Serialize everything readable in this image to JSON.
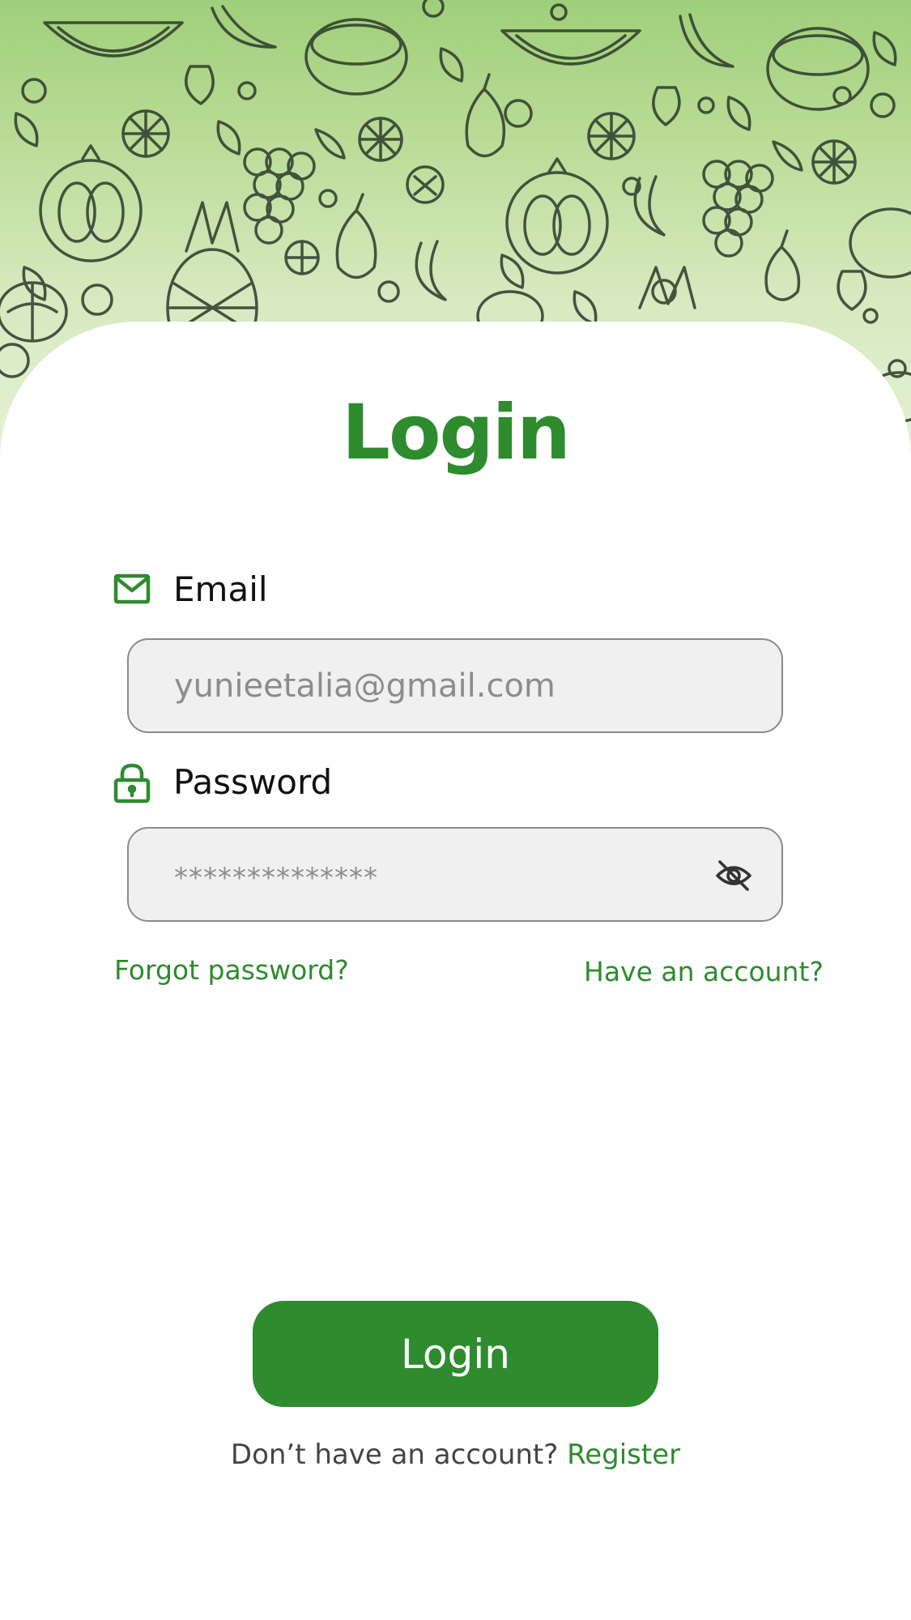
{
  "colors": {
    "accent": "#2e8b2e",
    "input_bg": "#f0f0f0",
    "input_border": "#8a8a8a",
    "placeholder": "#8c8c8c",
    "hero_top": "#9fcf7a",
    "hero_bottom": "#e8f2da"
  },
  "header": {
    "background": "fruit-doodle-pattern"
  },
  "page": {
    "title": "Login"
  },
  "email": {
    "icon": "envelope-icon",
    "label": "Email",
    "placeholder": "yunieetalia@gmail.com"
  },
  "password": {
    "icon": "lock-icon",
    "label": "Password",
    "value": "**************",
    "toggle_icon": "eye-off-icon"
  },
  "links": {
    "forgot": "Forgot password?",
    "have_account": "Have an account?"
  },
  "actions": {
    "login_label": "Login"
  },
  "footer": {
    "prompt": "Don’t have an account?",
    "register": "Register"
  }
}
